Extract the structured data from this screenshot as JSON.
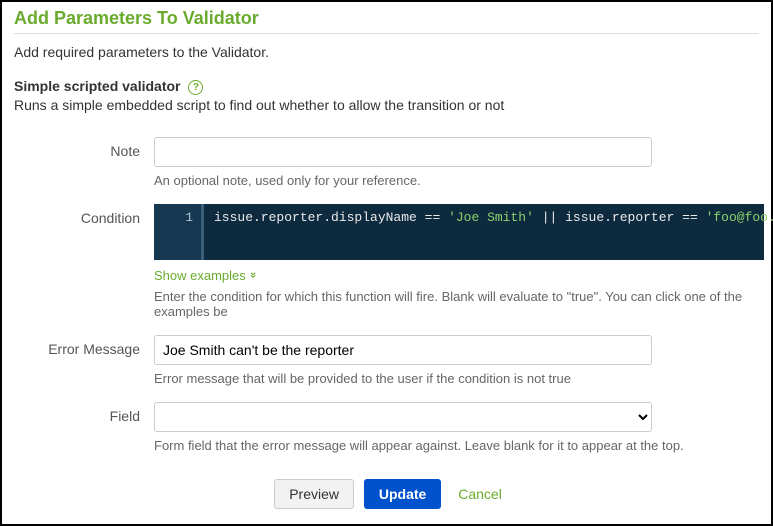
{
  "header": {
    "title": "Add Parameters To Validator",
    "description": "Add required parameters to the Validator."
  },
  "validator": {
    "name": "Simple scripted validator",
    "description": "Runs a simple embedded script to find out whether to allow the transition or not"
  },
  "form": {
    "note": {
      "label": "Note",
      "value": "",
      "help": "An optional note, used only for your reference."
    },
    "condition": {
      "label": "Condition",
      "code": {
        "line_no": "1",
        "tokens": [
          {
            "t": "plain",
            "v": "issue.reporter.displayName "
          },
          {
            "t": "op",
            "v": "=="
          },
          {
            "t": "plain",
            "v": " "
          },
          {
            "t": "str",
            "v": "'Joe Smith'"
          },
          {
            "t": "plain",
            "v": " "
          },
          {
            "t": "op",
            "v": "||"
          },
          {
            "t": "plain",
            "v": " issue.reporter "
          },
          {
            "t": "op",
            "v": "=="
          },
          {
            "t": "plain",
            "v": " "
          },
          {
            "t": "str",
            "v": "'foo@foo.com'"
          }
        ]
      },
      "show_examples": "Show examples",
      "help": "Enter the condition for which this function will fire. Blank will evaluate to \"true\". You can click one of the examples be"
    },
    "error_message": {
      "label": "Error Message",
      "value": "Joe Smith can't be the reporter",
      "help": "Error message that will be provided to the user if the condition is not true"
    },
    "field": {
      "label": "Field",
      "selected": "",
      "help": "Form field that the error message will appear against. Leave blank for it to appear at the top."
    }
  },
  "actions": {
    "preview": "Preview",
    "update": "Update",
    "cancel": "Cancel"
  }
}
